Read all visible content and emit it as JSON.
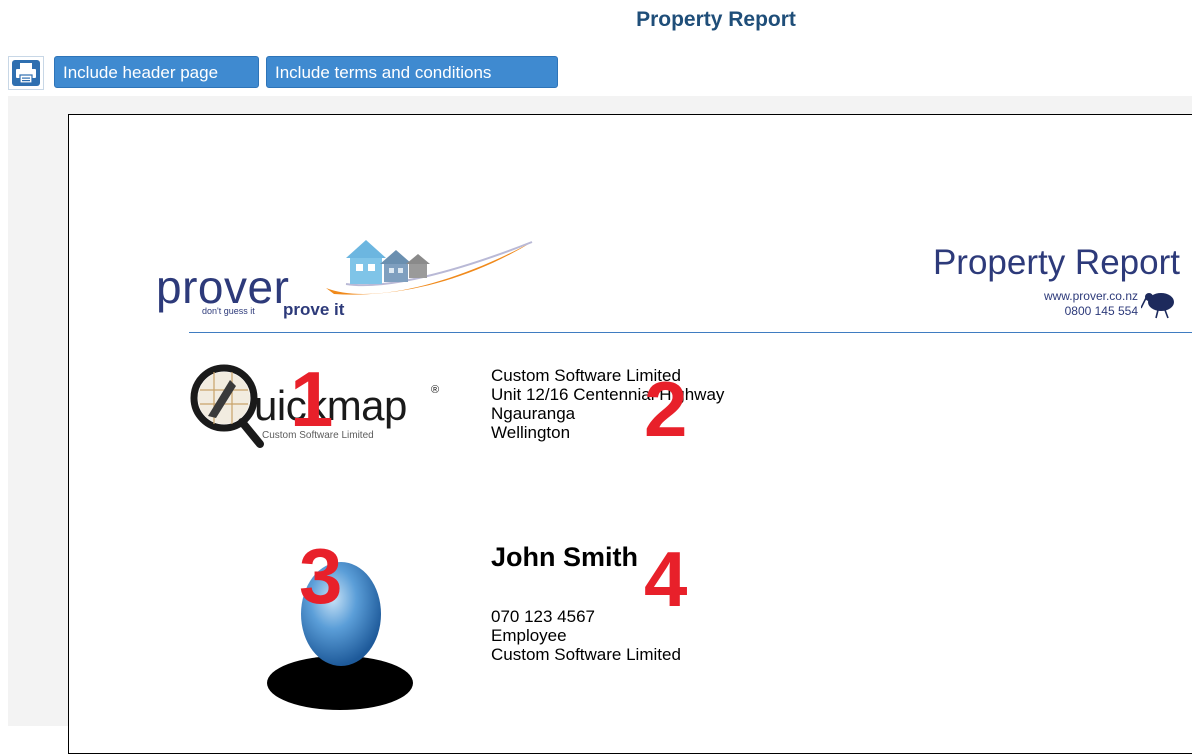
{
  "header": {
    "title": "Property Report"
  },
  "toolbar": {
    "include_header_label": "Include header page",
    "include_terms_label": "Include terms and conditions",
    "print_icon": "printer-icon"
  },
  "report": {
    "brand": {
      "name": "prover",
      "tagline_small": "don't guess it",
      "tagline_big": "prove it"
    },
    "title": "Property Report",
    "website": "www.prover.co.nz",
    "phone": "0800 145 554",
    "company_logo": {
      "text": "uickmap",
      "registered": "®",
      "subtext": "Custom Software Limited"
    },
    "address": [
      "Custom Software Limited",
      "Unit 12/16 Centennial Highway",
      "Ngauranga",
      "Wellington"
    ],
    "agent": {
      "name": "John Smith",
      "phone": "070 123 4567",
      "role": "Employee",
      "company": "Custom Software Limited"
    }
  },
  "annotations": [
    "1",
    "2",
    "3",
    "4"
  ],
  "colors": {
    "title_blue": "#1f4e79",
    "button_blue": "#3f8ad0",
    "brand_navy": "#2d3a7a",
    "brand_orange": "#f08a1c",
    "marker_red": "#e8202a"
  }
}
